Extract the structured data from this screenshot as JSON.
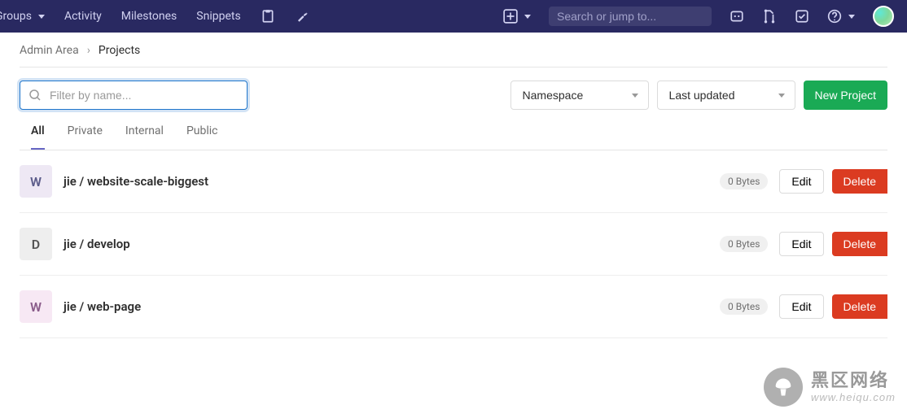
{
  "topnav": {
    "items": [
      "Groups",
      "Activity",
      "Milestones",
      "Snippets"
    ],
    "search_placeholder": "Search or jump to..."
  },
  "breadcrumb": {
    "root": "Admin Area",
    "current": "Projects"
  },
  "toolbar": {
    "filter_placeholder": "Filter by name...",
    "namespace_label": "Namespace",
    "sort_label": "Last updated",
    "new_button": "New Project"
  },
  "tabs": [
    "All",
    "Private",
    "Internal",
    "Public"
  ],
  "active_tab": "All",
  "projects": [
    {
      "avatar": "W",
      "avatar_class": "av-w",
      "namespace": "jie",
      "name": "website-scale-biggest",
      "size": "0 Bytes"
    },
    {
      "avatar": "D",
      "avatar_class": "av-d",
      "namespace": "jie",
      "name": "develop",
      "size": "0 Bytes"
    },
    {
      "avatar": "W",
      "avatar_class": "av-w2",
      "namespace": "jie",
      "name": "web-page",
      "size": "0 Bytes"
    }
  ],
  "row_actions": {
    "edit": "Edit",
    "delete": "Delete"
  },
  "watermark": {
    "text": "黑区网络",
    "url": "www.heiqu.com"
  }
}
